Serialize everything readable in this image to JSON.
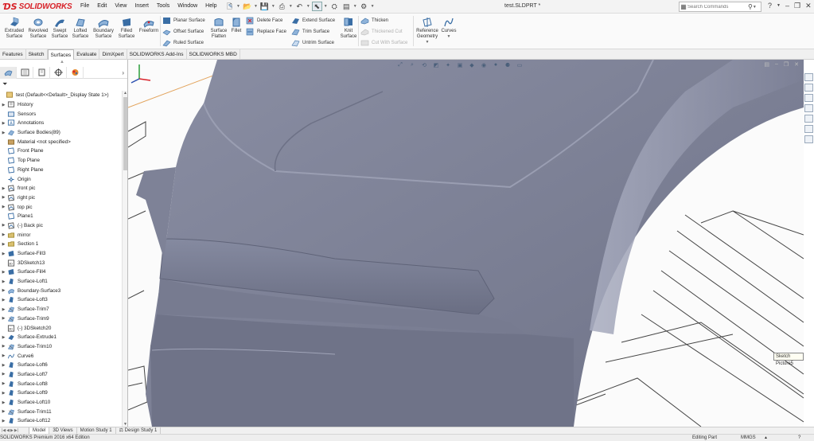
{
  "app": {
    "logo_text": "SOLIDWORKS",
    "document_title": "test.SLDPRT *"
  },
  "menu": [
    "File",
    "Edit",
    "View",
    "Insert",
    "Tools",
    "Window",
    "Help"
  ],
  "search": {
    "placeholder": "Search Commands"
  },
  "ribbon": {
    "big_buttons": [
      {
        "label": "Extruded Surface",
        "icon": "extruded-surface-icon"
      },
      {
        "label": "Revolved Surface",
        "icon": "revolved-surface-icon"
      },
      {
        "label": "Swept Surface",
        "icon": "swept-surface-icon"
      },
      {
        "label": "Lofted Surface",
        "icon": "lofted-surface-icon"
      },
      {
        "label": "Boundary Surface",
        "icon": "boundary-surface-icon"
      },
      {
        "label": "Filled Surface",
        "icon": "filled-surface-icon"
      },
      {
        "label": "Freeform",
        "icon": "freeform-icon"
      }
    ],
    "col1": [
      "Planar Surface",
      "Offset Surface",
      "Ruled Surface"
    ],
    "flatten": {
      "label": "Surface Flatten"
    },
    "fillet": {
      "label": "Fillet"
    },
    "col2": [
      "Delete Face",
      "Replace Face"
    ],
    "col3": [
      "Extend Surface",
      "Trim Surface",
      "Untrim Surface"
    ],
    "knit": {
      "label": "Knit Surface"
    },
    "col4": [
      "Thicken",
      "Thickened Cut",
      "Cut With Surface"
    ],
    "refgeom": {
      "label": "Reference Geometry"
    },
    "curves": {
      "label": "Curves"
    }
  },
  "tabs": [
    "Features",
    "Sketch",
    "Surfaces",
    "Evaluate",
    "DimXpert",
    "SOLIDWORKS Add-Ins",
    "SOLIDWORKS MBD"
  ],
  "active_tab": "Surfaces",
  "tree": [
    {
      "label": "test  (Default<<Default>_Display State 1>)",
      "icon": "part-icon",
      "expand": false,
      "root": true
    },
    {
      "label": "History",
      "icon": "history-icon",
      "expand": true
    },
    {
      "label": "Sensors",
      "icon": "sensors-icon",
      "expand": false
    },
    {
      "label": "Annotations",
      "icon": "annotations-icon",
      "expand": true
    },
    {
      "label": "Surface Bodies(89)",
      "icon": "surface-bodies-icon",
      "expand": true
    },
    {
      "label": "Material <not specified>",
      "icon": "material-icon",
      "expand": false
    },
    {
      "label": "Front Plane",
      "icon": "plane-icon",
      "expand": false
    },
    {
      "label": "Top Plane",
      "icon": "plane-icon",
      "expand": false
    },
    {
      "label": "Right Plane",
      "icon": "plane-icon",
      "expand": false
    },
    {
      "label": "Origin",
      "icon": "origin-icon",
      "expand": false
    },
    {
      "label": "front pic",
      "icon": "sketch-picture-icon",
      "expand": true
    },
    {
      "label": "right pic",
      "icon": "sketch-picture-icon",
      "expand": true
    },
    {
      "label": "top pic",
      "icon": "sketch-picture-icon",
      "expand": true
    },
    {
      "label": "Plane1",
      "icon": "plane-icon",
      "expand": false
    },
    {
      "label": "(-) Back pic",
      "icon": "sketch-picture-icon",
      "expand": true
    },
    {
      "label": "mirror",
      "icon": "folder-icon",
      "expand": true
    },
    {
      "label": "Section 1",
      "icon": "folder-icon",
      "expand": true
    },
    {
      "label": "Surface-Fill3",
      "icon": "surface-fill-icon",
      "expand": true
    },
    {
      "label": "3DSketch13",
      "icon": "sketch3d-icon",
      "expand": false
    },
    {
      "label": "Surface-Fill4",
      "icon": "surface-fill-icon",
      "expand": true
    },
    {
      "label": "Surface-Loft1",
      "icon": "surface-loft-icon",
      "expand": true
    },
    {
      "label": "Boundary-Surface3",
      "icon": "boundary-surface-icon",
      "expand": true
    },
    {
      "label": "Surface-Loft3",
      "icon": "surface-loft-icon",
      "expand": true
    },
    {
      "label": "Surface-Trim7",
      "icon": "surface-trim-icon",
      "expand": true
    },
    {
      "label": "Surface-Trim9",
      "icon": "surface-trim-icon",
      "expand": true
    },
    {
      "label": "(-) 3DSketch20",
      "icon": "sketch3d-icon",
      "expand": false
    },
    {
      "label": "Surface-Extrude1",
      "icon": "surface-extrude-icon",
      "expand": true
    },
    {
      "label": "Surface-Trim10",
      "icon": "surface-trim-icon",
      "expand": true
    },
    {
      "label": "Curve6",
      "icon": "curve-icon",
      "expand": true
    },
    {
      "label": "Surface-Loft6",
      "icon": "surface-loft-icon",
      "expand": true
    },
    {
      "label": "Surface-Loft7",
      "icon": "surface-loft-icon",
      "expand": true
    },
    {
      "label": "Surface-Loft8",
      "icon": "surface-loft-icon",
      "expand": true
    },
    {
      "label": "Surface-Loft9",
      "icon": "surface-loft-icon",
      "expand": true
    },
    {
      "label": "Surface-Loft10",
      "icon": "surface-loft-icon",
      "expand": true
    },
    {
      "label": "Surface-Trim11",
      "icon": "surface-trim-icon",
      "expand": true
    },
    {
      "label": "Surface-Loft12",
      "icon": "surface-loft-icon",
      "expand": true
    }
  ],
  "viewport": {
    "tooltip": "Sketch Picture5"
  },
  "bottom_tabs": [
    "Model",
    "3D Views",
    "Motion Study 1",
    "Design Study 1"
  ],
  "active_bottom_tab": "Model",
  "status": {
    "edition": "SOLIDWORKS Premium 2016 x64 Edition",
    "mode": "Editing Part",
    "units": "MMGS",
    "help": "?"
  },
  "colors": {
    "brand": "#d8232a",
    "surface": "#7c8096",
    "icon_blue": "#3a6ea5"
  }
}
